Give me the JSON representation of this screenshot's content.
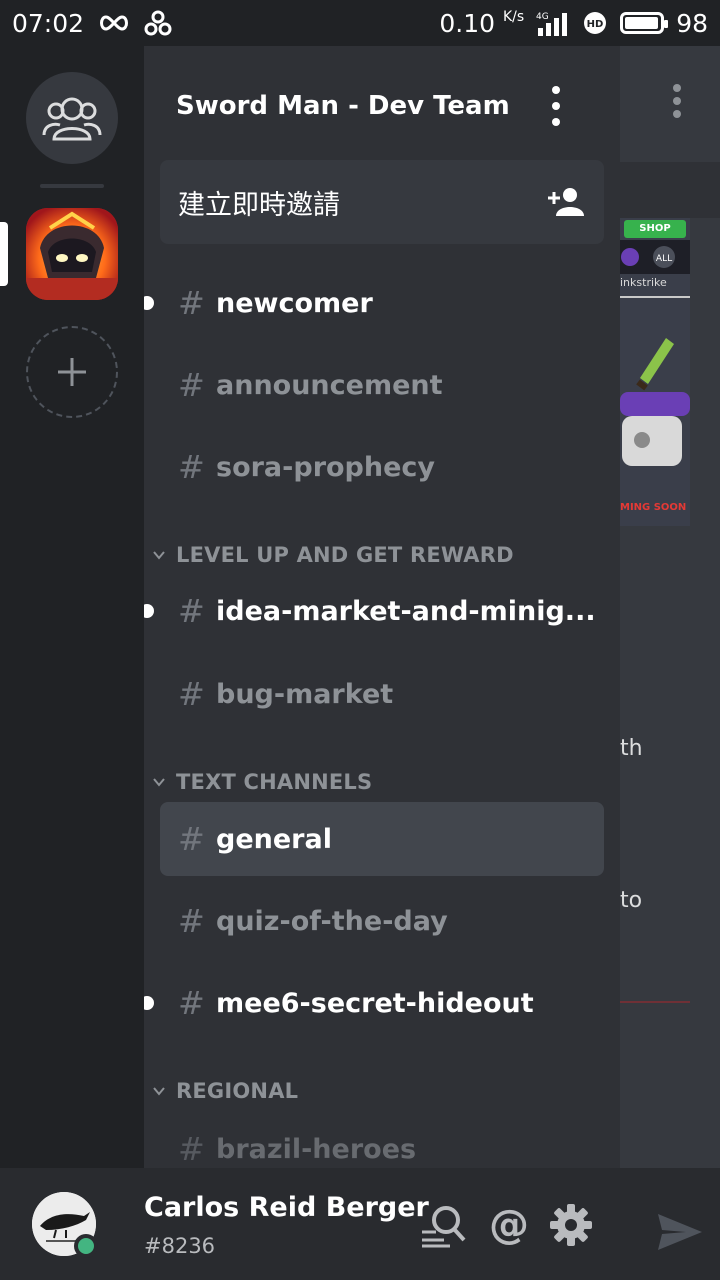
{
  "status_bar": {
    "time": "07:02",
    "speed_value": "0.10",
    "speed_unit": "K/s",
    "network": "4G",
    "battery": "98"
  },
  "server": {
    "name": "Sword Man - Dev Team"
  },
  "invite": {
    "label": "建立即時邀請"
  },
  "channels_top": [
    {
      "name": "newcomer",
      "unread": true
    },
    {
      "name": "announcement",
      "unread": false
    },
    {
      "name": "sora-prophecy",
      "unread": false
    }
  ],
  "categories": {
    "level_up": "LEVEL UP AND GET REWARD",
    "text": "TEXT CHANNELS",
    "regional": "REGIONAL"
  },
  "channels_level_up": [
    {
      "name": "idea-market-and-minig...",
      "unread": true
    },
    {
      "name": "bug-market",
      "unread": false
    }
  ],
  "channels_text": [
    {
      "name": "general",
      "selected": true
    },
    {
      "name": "quiz-of-the-day",
      "unread": false
    },
    {
      "name": "mee6-secret-hideout",
      "unread": true
    }
  ],
  "channels_regional": [
    {
      "name": "brazil-heroes"
    }
  ],
  "chat_peek": {
    "shop_label": "SHOP",
    "all_label": "ALL",
    "strike_label": "inkstrike",
    "soon_label": "MING SOON",
    "text_1": "th",
    "text_2": "to"
  },
  "user": {
    "name": "Carlos Reid Berger",
    "tag": "#8236"
  },
  "colors": {
    "accent_online": "#43b581",
    "selected_bg": "#42464d",
    "drawer_bg": "#2f3136"
  }
}
